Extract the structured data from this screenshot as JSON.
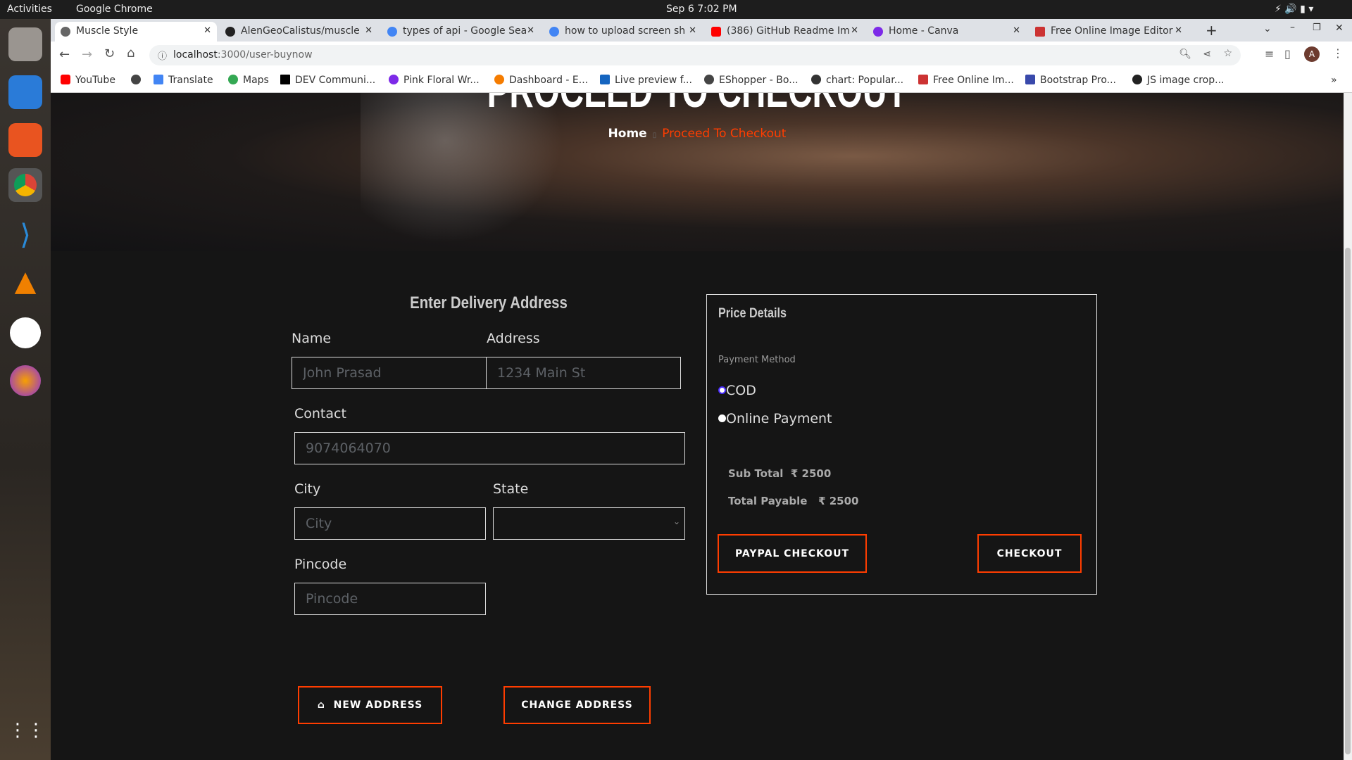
{
  "os": {
    "activities": "Activities",
    "app": "Google Chrome",
    "clock": "Sep 6  7:02 PM"
  },
  "tabs": [
    {
      "title": "Muscle Style",
      "active": true
    },
    {
      "title": "AlenGeoCalistus/muscle"
    },
    {
      "title": "types of api - Google Sea"
    },
    {
      "title": "how to upload screen sh"
    },
    {
      "title": "(386) GitHub Readme Im"
    },
    {
      "title": "Home - Canva"
    },
    {
      "title": "Free Online Image Editor"
    }
  ],
  "url": {
    "host": "localhost",
    "path": ":3000/user-buynow"
  },
  "bookmarks": [
    "YouTube",
    "",
    "Translate",
    "Maps",
    "DEV Communi...",
    "Pink Floral Wr...",
    "Dashboard - E...",
    "Live preview f...",
    "EShopper - Bo...",
    "chart: Popular...",
    "Free Online Im...",
    "Bootstrap Pro...",
    "JS image crop..."
  ],
  "hero": {
    "title": "PROCEED TO CHECKOUT",
    "crumb_home": "Home",
    "crumb_current": "Proceed To Checkout"
  },
  "form": {
    "heading": "Enter Delivery Address",
    "name_label": "Name",
    "name_placeholder": "John Prasad",
    "address_label": "Address",
    "address_placeholder": "1234 Main St",
    "contact_label": "Contact",
    "contact_placeholder": "9074064070",
    "city_label": "City",
    "city_placeholder": "City",
    "state_label": "State",
    "pincode_label": "Pincode",
    "pincode_placeholder": "Pincode",
    "new_address": "NEW ADDRESS",
    "change_address": "CHANGE ADDRESS"
  },
  "price": {
    "title": "Price Details",
    "payment_method": "Payment Method",
    "options": [
      {
        "label": "COD",
        "selected": true
      },
      {
        "label": "Online Payment",
        "selected": false
      }
    ],
    "subtotal_label": "Sub Total",
    "subtotal": "₹ 2500",
    "total_label": "Total Payable",
    "total": "₹ 2500",
    "paypal": "PAYPAL CHECKOUT",
    "checkout": "CHECKOUT"
  },
  "colors": {
    "accent": "#ff3d00",
    "bg": "#151515"
  }
}
